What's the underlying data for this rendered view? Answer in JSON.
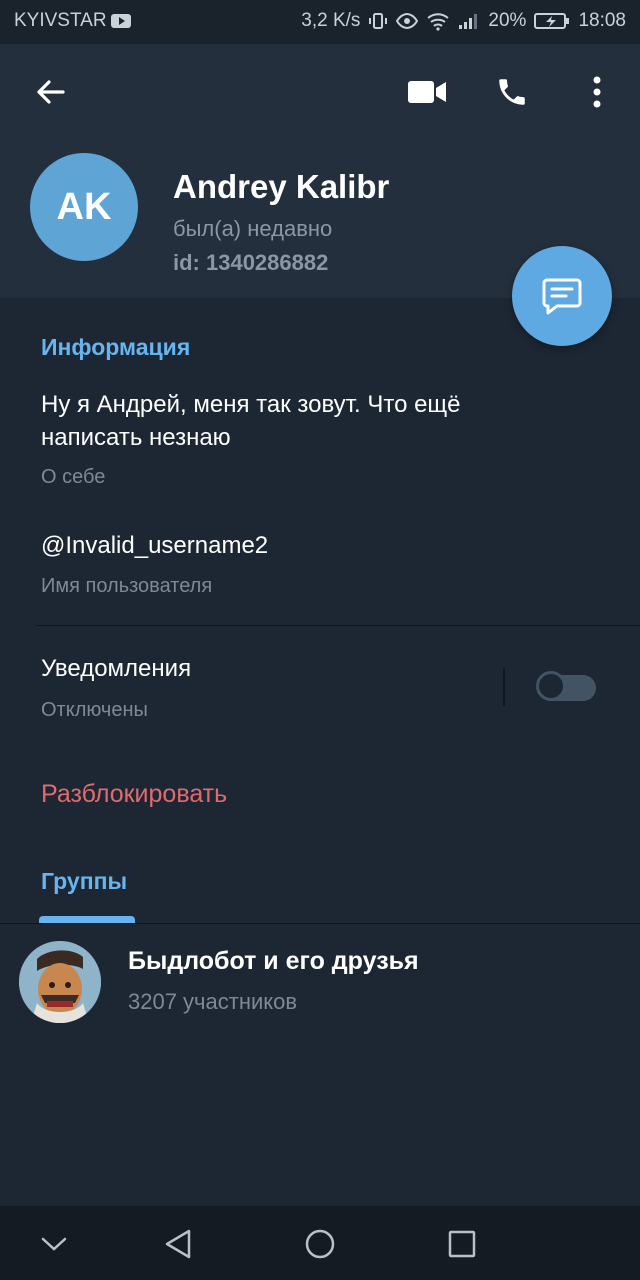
{
  "status_bar": {
    "carrier": "KYIVSTAR",
    "speed": "3,2 K/s",
    "battery": "20%",
    "time": "18:08"
  },
  "header": {
    "icons": [
      "back-arrow-icon",
      "video-call-icon",
      "phone-icon",
      "more-vertical-icon"
    ],
    "avatar_initials": "AK",
    "avatar_color": "#5ea5d6",
    "name": "Andrey Kalibr",
    "status": "был(а) недавно",
    "id": "id: 1340286882"
  },
  "info": {
    "section_title": "Информация",
    "bio_line1": "Ну я Андрей, меня так зовут. Что ещё",
    "bio_line2": "написать незнаю",
    "bio_label": "О себе",
    "username": "@Invalid_username2",
    "username_label": "Имя пользователя",
    "notifications_title": "Уведомления",
    "notifications_value": "Отключены",
    "notifications_enabled": false,
    "unblock": "Разблокировать"
  },
  "groups": {
    "tab_title": "Группы",
    "items": [
      {
        "name": "Быдлобот и его друзья",
        "members": "3207 участников"
      }
    ]
  },
  "nav_bar": {
    "icons": [
      "chevron-down-icon",
      "back-triangle-icon",
      "home-circle-icon",
      "recents-square-icon"
    ]
  },
  "colors": {
    "accent": "#67b5f0",
    "danger": "#e16a6f",
    "background": "#1d2733",
    "header": "#232f3c"
  }
}
